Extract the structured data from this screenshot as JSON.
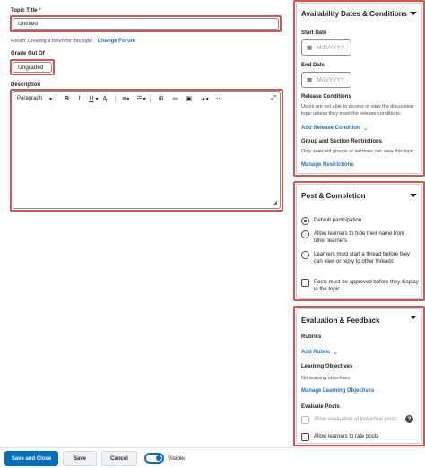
{
  "topic": {
    "title_label": "Topic Title",
    "required_mark": "*",
    "title_value": "Untitled",
    "forum_text": "Forum: Creating a forum for this topic",
    "change_forum": "Change Forum",
    "grade_label": "Grade Out Of",
    "grade_value": "Ungraded",
    "description_label": "Description"
  },
  "editor": {
    "paragraph": "Paragraph",
    "bold": "B",
    "italic": "I",
    "underline": "U",
    "plus": "+"
  },
  "availability": {
    "title": "Availability Dates & Conditions",
    "start_label": "Start Date",
    "start_placeholder": "M/D/YYYY",
    "end_label": "End Date",
    "end_placeholder": "M/D/YYYY",
    "release_title": "Release Conditions",
    "release_text": "Users are not able to access or view the discussion topic unless they meet the release conditions.",
    "add_release": "Add Release Condition",
    "group_title": "Group and Section Restrictions",
    "group_text": "Only selected groups or sections can view this topic",
    "manage_restrictions": "Manage Restrictions"
  },
  "post": {
    "title": "Post & Completion",
    "options": [
      "Default participation",
      "Allow learners to hide their name from other learners",
      "Learners must start a thread before they can view or reply to other threads"
    ],
    "approve": "Posts must be approved before they display in the topic"
  },
  "evaluation": {
    "title": "Evaluation & Feedback",
    "rubrics_label": "Rubrics",
    "add_rubric": "Add Rubric",
    "objectives_label": "Learning Objectives",
    "no_objectives": "No learning objectives",
    "manage_objectives": "Manage Learning Objectives",
    "evaluate_label": "Evaluate Posts",
    "allow_eval": "Allow evaluation of individual posts",
    "allow_rate": "Allow learners to rate posts"
  },
  "footer": {
    "save_close": "Save and Close",
    "save": "Save",
    "cancel": "Cancel",
    "visible": "Visible"
  },
  "colors": {
    "accent": "#1e6fba",
    "highlight": "#d9534f",
    "primary_button": "#006fbf"
  }
}
